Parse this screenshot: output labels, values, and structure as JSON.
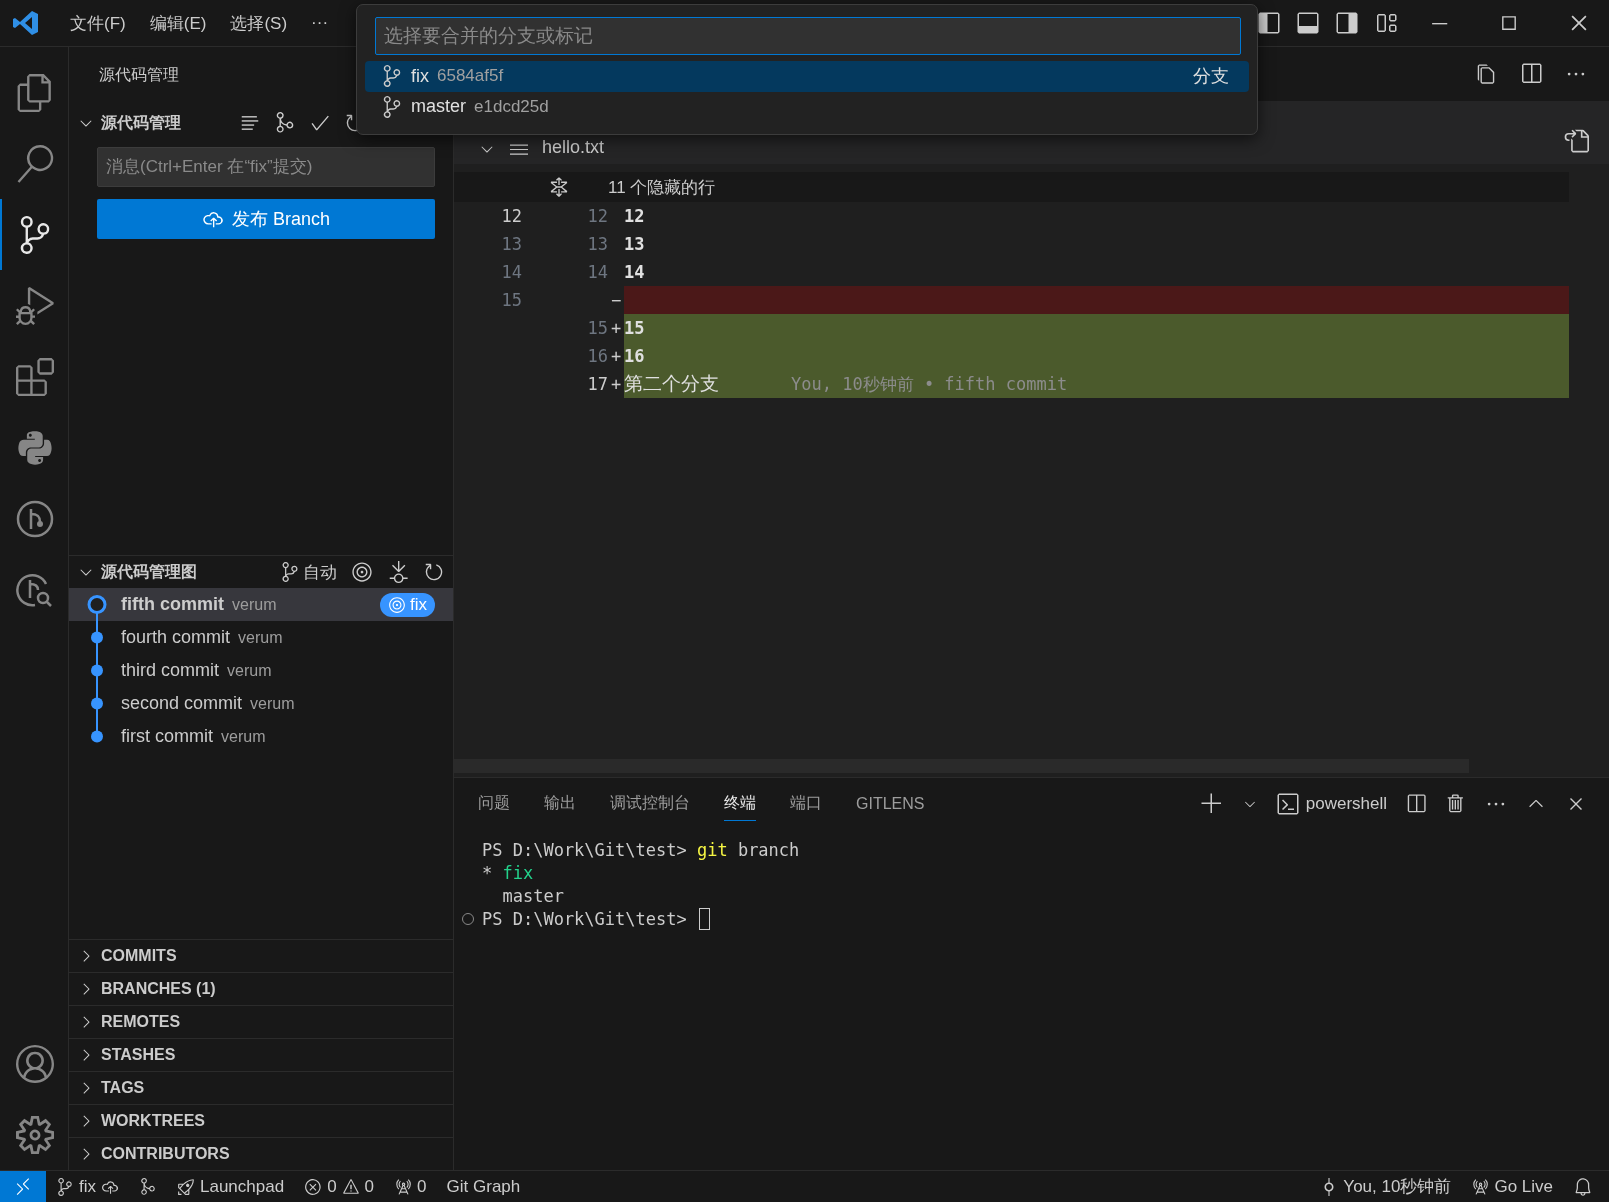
{
  "title_bar": {
    "menus": [
      "文件(F)",
      "编辑(E)",
      "选择(S)",
      "···"
    ]
  },
  "quick_pick": {
    "placeholder": "选择要合并的分支或标记",
    "items": [
      {
        "name": "fix",
        "hash": "6584af5f",
        "tag": "分支",
        "selected": true
      },
      {
        "name": "master",
        "hash": "e1dcd25d",
        "selected": false
      }
    ]
  },
  "activity_bar": {
    "items": [
      {
        "kind": "explorer",
        "selected": false
      },
      {
        "kind": "search",
        "selected": false
      },
      {
        "kind": "source-control",
        "selected": true
      },
      {
        "kind": "debug",
        "selected": false
      },
      {
        "kind": "extensions",
        "selected": false
      },
      {
        "kind": "python",
        "selected": false
      },
      {
        "kind": "gitlens",
        "selected": false
      },
      {
        "kind": "git-inspect",
        "selected": false
      }
    ]
  },
  "sidebar": {
    "title": "源代码管理",
    "section_title": "源代码管理",
    "message_placeholder": "消息(Ctrl+Enter 在“fix”提交)",
    "publish_button": "发布 Branch",
    "graph": {
      "title": "源代码管理图",
      "mode": "自动",
      "commits": [
        {
          "message": "fifth commit",
          "author": "verum",
          "selected": true,
          "branch": "fix"
        },
        {
          "message": "fourth commit",
          "author": "verum",
          "selected": false
        },
        {
          "message": "third commit",
          "author": "verum",
          "selected": false
        },
        {
          "message": "second commit",
          "author": "verum",
          "selected": false
        },
        {
          "message": "first commit",
          "author": "verum",
          "selected": false
        }
      ]
    },
    "sections": [
      "COMMITS",
      "BRANCHES (1)",
      "REMOTES",
      "STASHES",
      "TAGS",
      "WORKTREES",
      "CONTRIBUTORS"
    ]
  },
  "editor": {
    "file": "hello.txt",
    "hidden_lines": "11 个隐藏的行",
    "lines": [
      {
        "kind": "same",
        "old": "12",
        "new": "12",
        "text": "12",
        "current": true
      },
      {
        "kind": "same",
        "old": "13",
        "new": "13",
        "text": "13",
        "current": false
      },
      {
        "kind": "same",
        "old": "14",
        "new": "14",
        "text": "14",
        "current": false
      },
      {
        "kind": "removed",
        "old": "15",
        "sign": "−",
        "current": false
      },
      {
        "kind": "added",
        "new": "15",
        "sign": "+",
        "text": "15",
        "current": false
      },
      {
        "kind": "added",
        "new": "16",
        "sign": "+",
        "text": "16",
        "current": false
      },
      {
        "kind": "added",
        "new": "17",
        "sign": "+",
        "text": "第二个分支",
        "blame": "You, 10秒钟前 • fifth commit",
        "current": true
      }
    ]
  },
  "panel": {
    "tabs": [
      {
        "label": "问题",
        "selected": false
      },
      {
        "label": "输出",
        "selected": false
      },
      {
        "label": "调试控制台",
        "selected": false
      },
      {
        "label": "终端",
        "selected": true
      },
      {
        "label": "端口",
        "selected": false
      },
      {
        "label": "GITLENS",
        "selected": false
      }
    ],
    "terminal_name": "powershell",
    "terminal_lines": [
      {
        "decorated": false,
        "cursor": false,
        "segments": [
          {
            "kind": "plain",
            "text": "PS D:\\Work\\Git\\test> "
          },
          {
            "kind": "command",
            "text": "git"
          },
          {
            "kind": "plain",
            "text": " branch"
          }
        ]
      },
      {
        "decorated": false,
        "cursor": false,
        "segments": [
          {
            "kind": "plain",
            "text": "* "
          },
          {
            "kind": "current",
            "text": "fix"
          }
        ]
      },
      {
        "decorated": false,
        "cursor": false,
        "segments": [
          {
            "kind": "plain",
            "text": "  master"
          }
        ]
      },
      {
        "decorated": true,
        "cursor": true,
        "segments": [
          {
            "kind": "plain",
            "text": "PS D:\\Work\\Git\\test> "
          }
        ]
      }
    ]
  },
  "status_bar": {
    "branch": "fix",
    "launchpad": "Launchpad",
    "errors": "0",
    "warnings": "0",
    "ports": "0",
    "git_graph": "Git Graph",
    "blame": "You, 10秒钟前",
    "go_live": "Go Live"
  }
}
